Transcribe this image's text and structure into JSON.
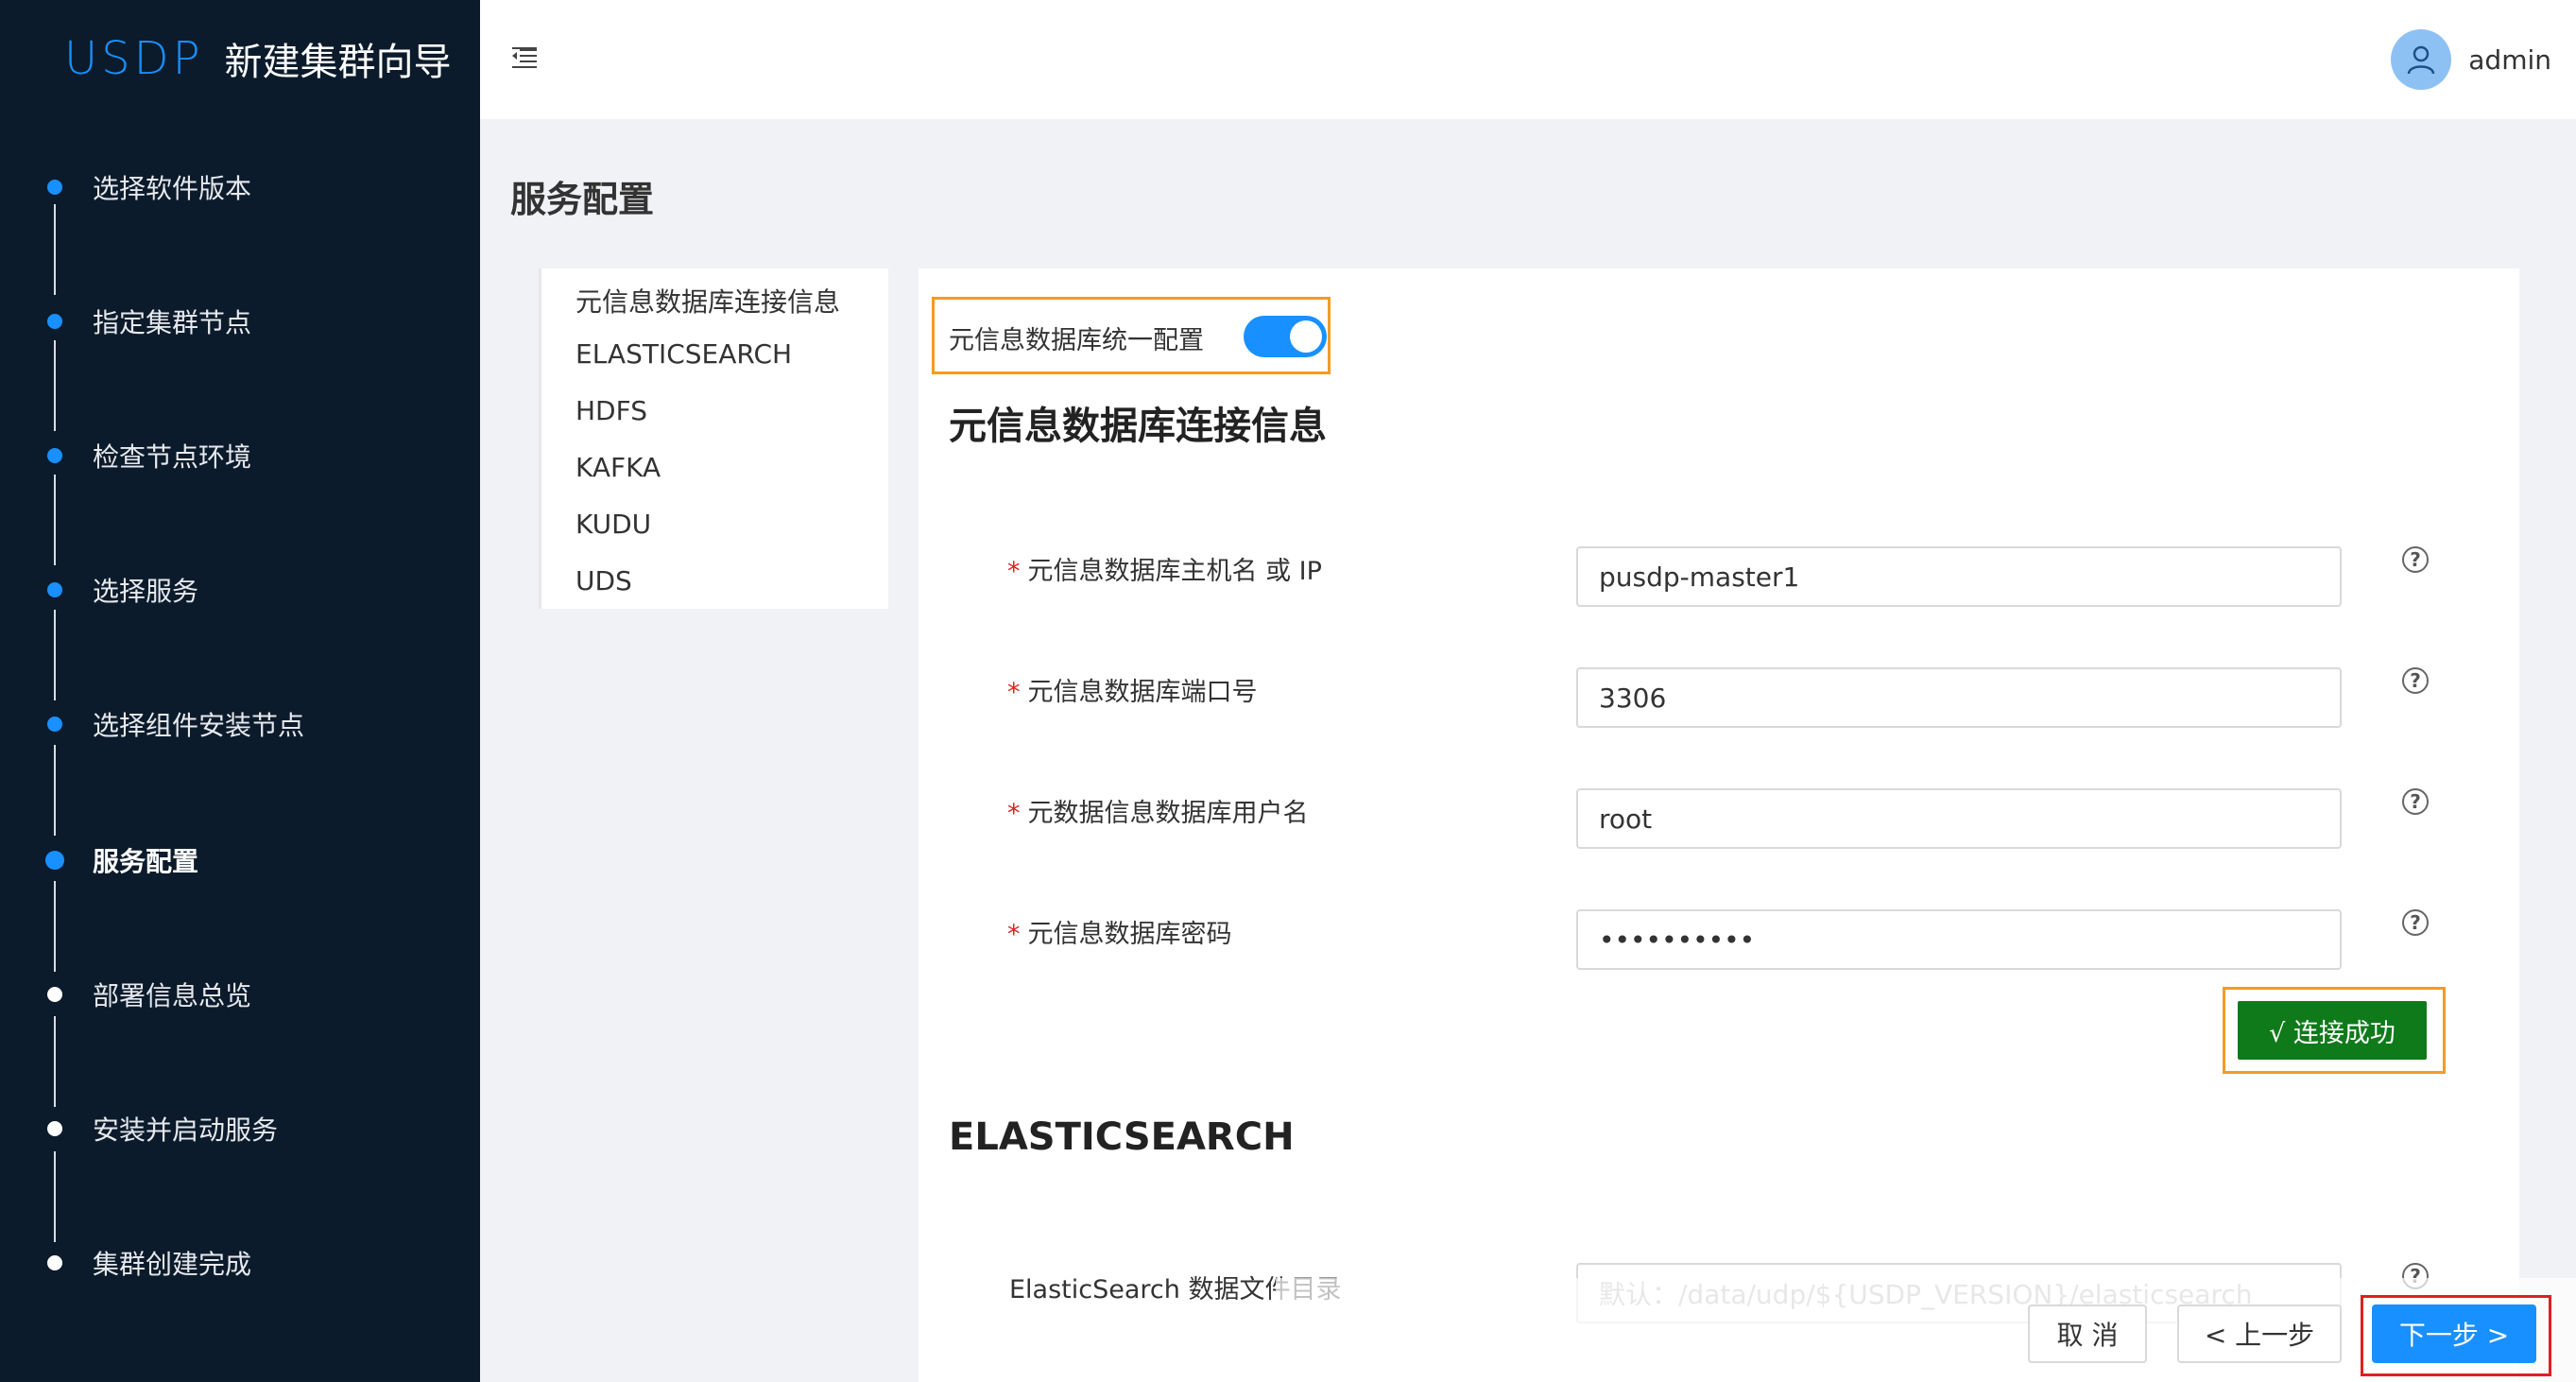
{
  "app": {
    "logo": "USDP",
    "title": "新建集群向导"
  },
  "steps": [
    {
      "label": "选择软件版本",
      "state": "done"
    },
    {
      "label": "指定集群节点",
      "state": "done"
    },
    {
      "label": "检查节点环境",
      "state": "done"
    },
    {
      "label": "选择服务",
      "state": "done"
    },
    {
      "label": "选择组件安装节点",
      "state": "done"
    },
    {
      "label": "服务配置",
      "state": "current"
    },
    {
      "label": "部署信息总览",
      "state": "pending"
    },
    {
      "label": "安装并启动服务",
      "state": "pending"
    },
    {
      "label": "集群创建完成",
      "state": "pending"
    }
  ],
  "header": {
    "menu_icon": "menu-fold-icon",
    "user_icon": "user-icon",
    "username": "admin"
  },
  "page": {
    "title": "服务配置"
  },
  "subnav": {
    "items": [
      "元信息数据库连接信息",
      "ELASTICSEARCH",
      "HDFS",
      "KAFKA",
      "KUDU",
      "UDS"
    ]
  },
  "config": {
    "unified_label": "元信息数据库统一配置",
    "unified_enabled": true,
    "section1_title": "元信息数据库连接信息",
    "fields": [
      {
        "label": "元信息数据库主机名 或 IP",
        "value": "pusdp-master1",
        "required": true
      },
      {
        "label": "元信息数据库端口号",
        "value": "3306",
        "required": true
      },
      {
        "label": "元数据信息数据库用户名",
        "value": "root",
        "required": true
      },
      {
        "label": "元信息数据库密码",
        "value": "••••••••••",
        "required": true
      }
    ],
    "required_mark": "*",
    "help_mark": "?",
    "connect_label": "√ 连接成功",
    "section2_title": "ELASTICSEARCH",
    "es_field_label": "ElasticSearch 数据文件目录",
    "es_field_placeholder": "默认：/data/udp/${USDP_VERSION}/elasticsearch"
  },
  "footer": {
    "cancel": "取 消",
    "prev": "< 上一步",
    "next": "下一步 >"
  },
  "colors": {
    "sidebar_bg": "#0c1b2b",
    "accent": "#1890ff",
    "success": "#0f7a1a",
    "highlight_orange": "#f59a23",
    "highlight_red": "#e02020"
  }
}
